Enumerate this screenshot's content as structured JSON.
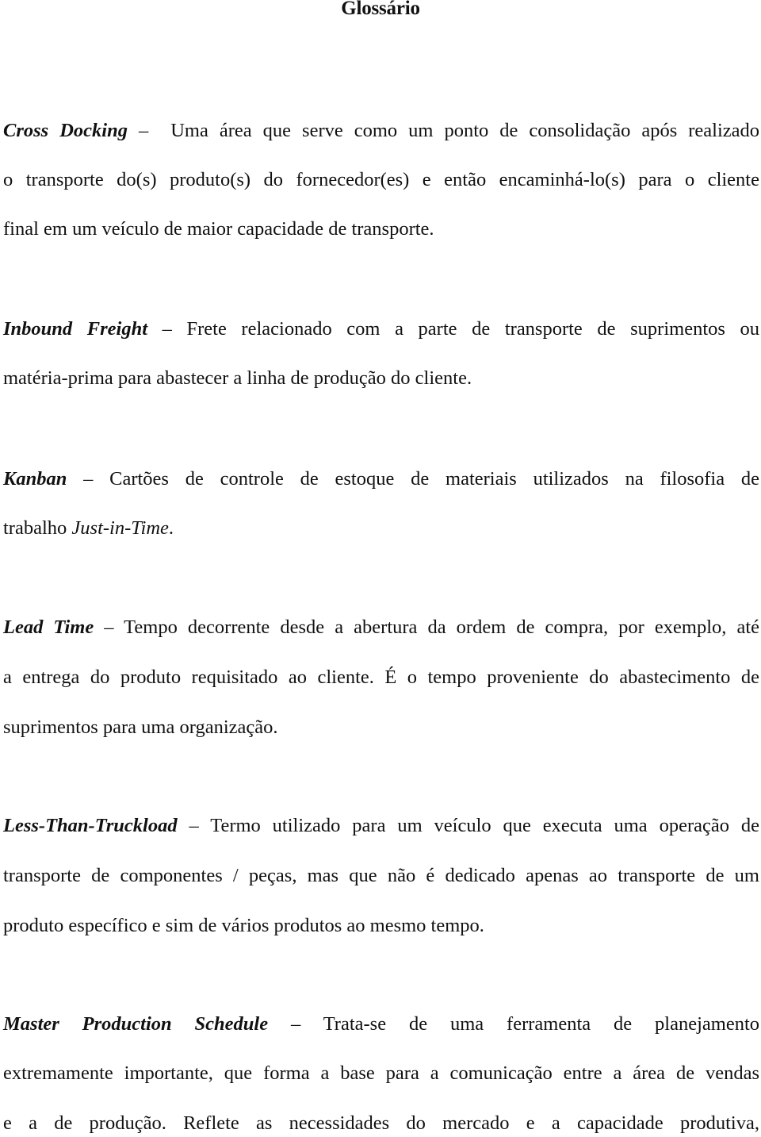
{
  "document": {
    "title": "Glossário",
    "separator": "–",
    "entries": [
      {
        "term": "Cross Docking",
        "lines": [
          "Uma área que serve como um ponto de consolidação após realizado",
          "o transporte do(s) produto(s) do fornecedor(es) e então encaminhá-lo(s) para o cliente",
          "final em um veículo de maior capacidade de transporte."
        ]
      },
      {
        "term": "Inbound Freight",
        "lines": [
          "Frete relacionado com a parte de transporte de suprimentos ou",
          "matéria-prima para abastecer a linha de produção do cliente."
        ]
      },
      {
        "term": "Kanban",
        "lines": [
          "Cartões de controle de estoque de materiais utilizados na filosofia de",
          "trabalho"
        ],
        "italic_tail": "Just-in-Time",
        "tail_punct": "."
      },
      {
        "term": "Lead Time",
        "lines": [
          "Tempo decorrente desde a abertura da ordem de compra, por exemplo, até",
          "a entrega do produto requisitado ao cliente. É o tempo proveniente do abastecimento de",
          "suprimentos para uma organização."
        ]
      },
      {
        "term": "Less-Than-Truckload",
        "lines": [
          "Termo utilizado para um veículo que executa uma operação de",
          "transporte de componentes / peças, mas que não é dedicado apenas ao transporte de um",
          "produto específico e sim de vários produtos ao mesmo tempo."
        ]
      },
      {
        "term": "Master Production Schedule",
        "lines": [
          "Trata-se de uma ferramenta de planejamento",
          "extremamente importante, que forma a base para a comunicação entre a área de vendas",
          "e a de produção. Reflete as necessidades do mercado e a capacidade produtiva,"
        ]
      }
    ]
  }
}
